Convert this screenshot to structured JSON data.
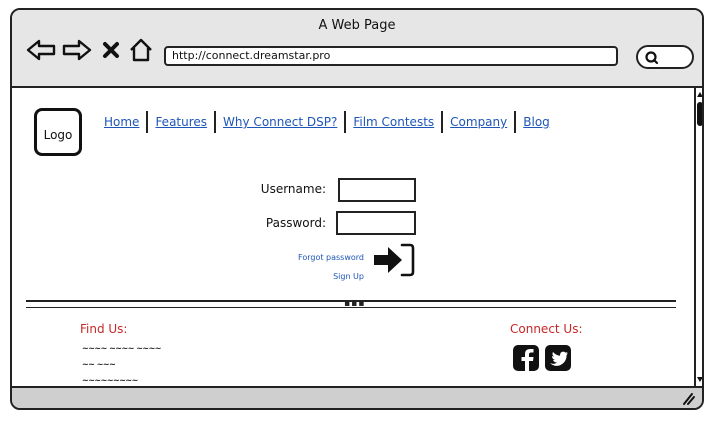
{
  "window": {
    "title": "A Web Page"
  },
  "browser": {
    "url": "http://connect.dreamstar.pro",
    "icons": [
      "back-arrow-icon",
      "forward-arrow-icon",
      "close-x-icon",
      "home-icon",
      "search-icon"
    ]
  },
  "header": {
    "logo_label": "Logo",
    "nav_items": [
      {
        "label": "Home"
      },
      {
        "label": "Features"
      },
      {
        "label": "Why Connect DSP?"
      },
      {
        "label": "Film Contests"
      },
      {
        "label": "Company"
      },
      {
        "label": "Blog"
      }
    ],
    "link_color": "#1e56b8"
  },
  "login": {
    "username_label": "Username:",
    "password_label": "Password:",
    "forgot_password": "Forgot password",
    "sign_up": "Sign Up",
    "submit_icon": "sign-in-icon"
  },
  "footer": {
    "find_us_heading": "Find Us:",
    "address_lines": [
      "~~~~ ~~~~ ~~~~",
      "~~ ~~~",
      "~~~~~~~~~"
    ],
    "connect_heading": "Connect Us:",
    "heading_color": "#c62828",
    "social_icons": [
      "facebook-icon",
      "twitter-icon"
    ]
  }
}
